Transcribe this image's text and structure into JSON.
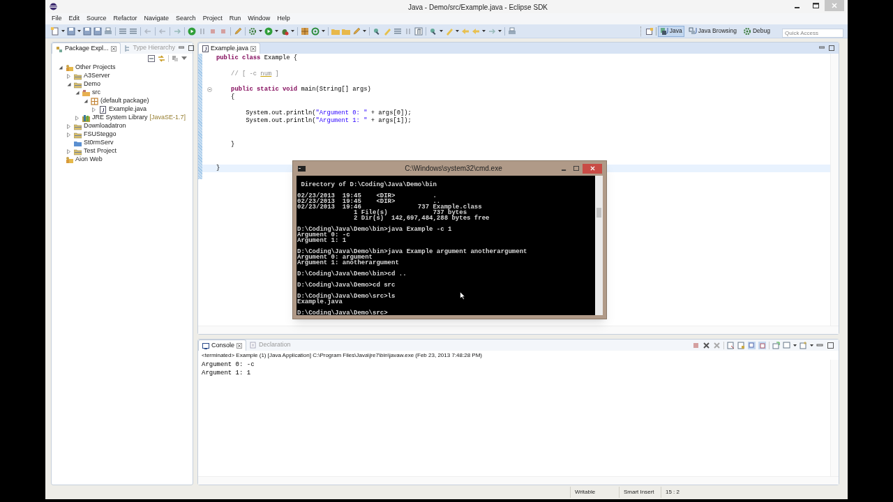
{
  "window": {
    "title": "Java - Demo/src/Example.java - Eclipse SDK"
  },
  "menu": [
    "File",
    "Edit",
    "Source",
    "Refactor",
    "Navigate",
    "Search",
    "Project",
    "Run",
    "Window",
    "Help"
  ],
  "perspectives": [
    {
      "label": "Java",
      "kind": "java",
      "selected": true
    },
    {
      "label": "Java Browsing",
      "kind": "browsing",
      "selected": false
    },
    {
      "label": "Debug",
      "kind": "debug",
      "selected": false
    }
  ],
  "quick_access": {
    "placeholder": "Quick Access"
  },
  "explorer": {
    "tabs": [
      {
        "label": "Package Expl...",
        "kind": "package",
        "selected": true
      },
      {
        "label": "Type Hierarchy",
        "kind": "hierarchy",
        "selected": false
      }
    ],
    "tree": [
      {
        "label": "Other Projects",
        "kind": "working-set",
        "expandable": true,
        "expanded": true,
        "children": [
          {
            "label": "A3Server",
            "kind": "project",
            "expandable": true,
            "expanded": false
          },
          {
            "label": "Demo",
            "kind": "project",
            "expandable": true,
            "expanded": true,
            "children": [
              {
                "label": "src",
                "kind": "source-folder",
                "expandable": true,
                "expanded": true,
                "children": [
                  {
                    "label": "(default package)",
                    "kind": "package",
                    "expandable": true,
                    "expanded": true,
                    "children": [
                      {
                        "label": "Example.java",
                        "kind": "java-file",
                        "expandable": true,
                        "expanded": false
                      }
                    ]
                  }
                ]
              },
              {
                "label": "JRE System Library",
                "decoration": "[JavaSE-1.7]",
                "kind": "library",
                "expandable": true,
                "expanded": false
              }
            ]
          },
          {
            "label": "Downloadatron",
            "kind": "project",
            "expandable": true,
            "expanded": false
          },
          {
            "label": "FSUSteggo",
            "kind": "project",
            "expandable": true,
            "expanded": false
          },
          {
            "label": "St0rmServ",
            "kind": "closed-project",
            "expandable": false
          },
          {
            "label": "Test Project",
            "kind": "project",
            "expandable": true,
            "expanded": false
          }
        ]
      },
      {
        "label": "Aion Web",
        "kind": "working-set",
        "expandable": false
      }
    ]
  },
  "editor": {
    "tabs": [
      {
        "label": "Example.java",
        "selected": true
      }
    ],
    "lines": [
      {
        "kind": "code",
        "current": false,
        "segments": [
          {
            "kind": "keyword",
            "text": "public class"
          },
          {
            "kind": "plain",
            "text": " Example {"
          }
        ]
      },
      {
        "kind": "blank",
        "current": false
      },
      {
        "kind": "code",
        "current": false,
        "segments": [
          {
            "kind": "comment",
            "text": "    // [ -c "
          },
          {
            "kind": "misspelled",
            "text": "num"
          },
          {
            "kind": "comment",
            "text": " ]"
          }
        ]
      },
      {
        "kind": "blank",
        "current": false
      },
      {
        "kind": "code",
        "current": false,
        "folding": true,
        "segments": [
          {
            "kind": "keyword",
            "text": "    public static void"
          },
          {
            "kind": "plain",
            "text": " main(String[] args)"
          }
        ]
      },
      {
        "kind": "code",
        "current": false,
        "segments": [
          {
            "kind": "plain",
            "text": "    {"
          }
        ]
      },
      {
        "kind": "blank",
        "current": false
      },
      {
        "kind": "code",
        "current": false,
        "segments": [
          {
            "kind": "plain",
            "text": "        System.out.println("
          },
          {
            "kind": "string",
            "text": "\"Argument 0: \""
          },
          {
            "kind": "plain",
            "text": " + args[0]);"
          }
        ]
      },
      {
        "kind": "code",
        "current": false,
        "segments": [
          {
            "kind": "plain",
            "text": "        System.out.println("
          },
          {
            "kind": "string",
            "text": "\"Argument 1: \""
          },
          {
            "kind": "plain",
            "text": " + args[1]);"
          }
        ]
      },
      {
        "kind": "blank",
        "current": false
      },
      {
        "kind": "blank",
        "current": false
      },
      {
        "kind": "code",
        "current": false,
        "segments": [
          {
            "kind": "plain",
            "text": "    }"
          }
        ]
      },
      {
        "kind": "blank",
        "current": false
      },
      {
        "kind": "blank",
        "current": false
      },
      {
        "kind": "code",
        "current": true,
        "segments": [
          {
            "kind": "plain",
            "text": "}"
          }
        ]
      }
    ]
  },
  "console": {
    "tabs": [
      {
        "label": "Console",
        "kind": "console",
        "selected": true
      },
      {
        "label": "Declaration",
        "kind": "declaration",
        "selected": false
      }
    ],
    "header": "<terminated> Example (1) [Java Application] C:\\Program Files\\Java\\jre7\\bin\\javaw.exe (Feb 23, 2013 7:48:28 PM)",
    "output": [
      "Argument 0: -c",
      "Argument 1: 1"
    ]
  },
  "status_bar": [
    "Writable",
    "Smart Insert",
    "15 : 2"
  ],
  "cmd": {
    "title": "C:\\Windows\\system32\\cmd.exe",
    "output": " Directory of D:\\Coding\\Java\\Demo\\bin\n\n02/23/2013  19:45    <DIR>          .\n02/23/2013  19:45    <DIR>          ..\n02/23/2013  19:46               737 Example.class\n               1 File(s)            737 bytes\n               2 Dir(s)  142,697,484,288 bytes free\n\nD:\\Coding\\Java\\Demo\\bin>java Example -c 1\nArgument 0: -c\nArgument 1: 1\n\nD:\\Coding\\Java\\Demo\\bin>java Example argument anotherargument\nArgument 0: argument\nArgument 1: anotherargument\n\nD:\\Coding\\Java\\Demo\\bin>cd ..\n\nD:\\Coding\\Java\\Demo>cd src\n\nD:\\Coding\\Java\\Demo\\src>ls\nExample.java\n\nD:\\Coding\\Java\\Demo\\src>"
  }
}
